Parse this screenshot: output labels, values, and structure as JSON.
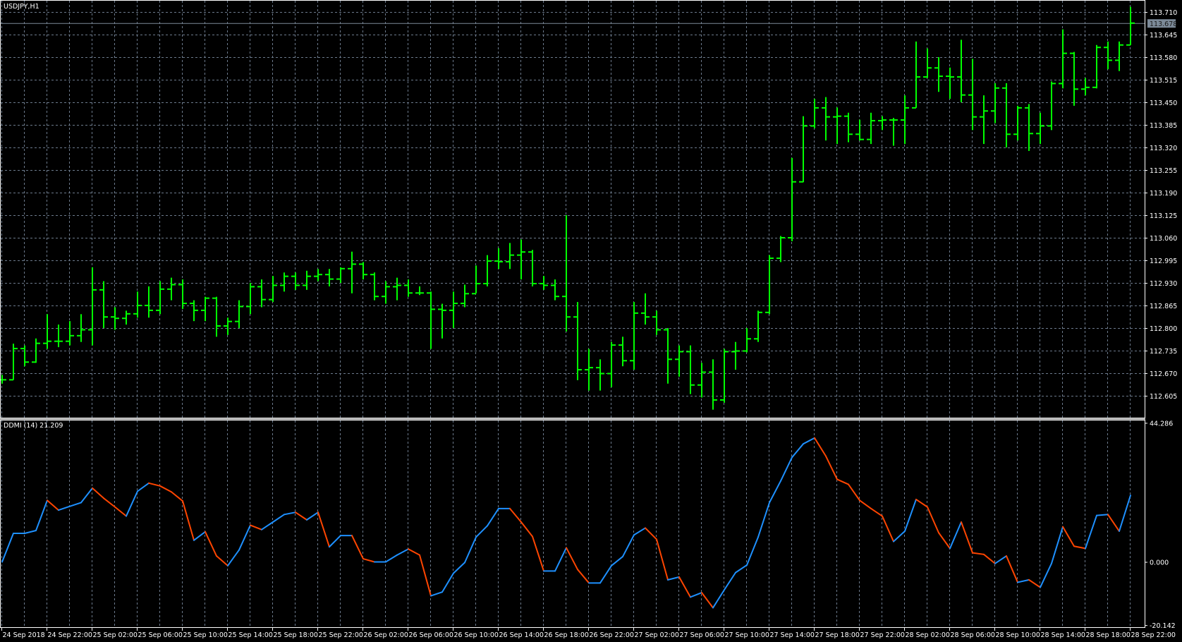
{
  "chart_data": [
    {
      "type": "ohlc",
      "title": "USDJPY,H1",
      "current_price": "113.678",
      "ylim": [
        112.542,
        113.745
      ],
      "y_ticks": [
        "113.710",
        "113.645",
        "113.580",
        "113.515",
        "113.450",
        "113.385",
        "113.320",
        "113.255",
        "113.190",
        "113.125",
        "113.060",
        "112.995",
        "112.930",
        "112.865",
        "112.800",
        "112.735",
        "112.670",
        "112.605"
      ],
      "close": [
        112.651,
        112.741,
        112.702,
        112.756,
        112.762,
        112.762,
        112.778,
        112.795,
        112.91,
        112.832,
        112.828,
        112.841,
        112.865,
        112.851,
        112.912,
        112.925,
        112.871,
        112.851,
        112.886,
        112.806,
        112.819,
        112.862,
        112.919,
        112.882,
        112.923,
        112.949,
        112.923,
        112.949,
        112.954,
        112.941,
        112.971,
        112.984,
        112.954,
        112.891,
        112.919,
        112.923,
        112.901,
        112.901,
        112.854,
        112.851,
        112.871,
        112.899,
        112.928,
        112.993,
        112.991,
        113.01,
        113.019,
        112.928,
        112.923,
        112.891,
        112.832,
        112.68,
        112.686,
        112.669,
        112.751,
        112.706,
        112.843,
        112.832,
        112.795,
        112.71,
        112.732,
        112.636,
        112.673,
        112.593,
        112.732,
        112.734,
        112.769,
        112.845,
        113.001,
        113.06,
        113.221,
        113.382,
        113.434,
        113.408,
        113.41,
        113.358,
        113.343,
        113.397,
        113.399,
        113.399,
        113.434,
        113.523,
        113.549,
        113.525,
        113.523,
        113.471,
        113.408,
        113.425,
        113.491,
        113.358,
        113.434,
        113.36,
        113.382,
        113.504,
        113.591,
        113.488,
        113.493,
        113.608,
        113.571,
        113.615,
        113.678
      ],
      "high": [
        112.665,
        112.755,
        112.75,
        112.77,
        112.84,
        112.81,
        112.82,
        112.84,
        112.975,
        112.935,
        112.86,
        112.85,
        112.905,
        112.92,
        112.935,
        112.945,
        112.94,
        112.88,
        112.89,
        112.89,
        112.83,
        112.88,
        112.93,
        112.94,
        112.95,
        112.96,
        112.96,
        112.965,
        112.97,
        112.97,
        112.975,
        113.02,
        112.99,
        112.96,
        112.935,
        112.945,
        112.94,
        112.92,
        112.905,
        112.87,
        112.905,
        112.925,
        112.98,
        113.01,
        113.03,
        113.045,
        113.055,
        113.025,
        112.95,
        112.94,
        113.125,
        112.875,
        112.74,
        112.71,
        112.76,
        112.775,
        112.875,
        112.9,
        112.85,
        112.8,
        112.75,
        112.75,
        112.7,
        112.71,
        112.74,
        112.76,
        112.8,
        112.85,
        113.01,
        113.065,
        113.29,
        113.41,
        113.46,
        113.465,
        113.435,
        113.42,
        113.4,
        113.42,
        113.41,
        113.405,
        113.47,
        113.625,
        113.605,
        113.58,
        113.55,
        113.63,
        113.575,
        113.47,
        113.505,
        113.505,
        113.44,
        113.445,
        113.42,
        113.51,
        113.66,
        113.595,
        113.52,
        113.615,
        113.625,
        113.625,
        113.725
      ],
      "low": [
        112.64,
        112.651,
        112.69,
        112.7,
        112.74,
        112.745,
        112.75,
        112.76,
        112.75,
        112.8,
        112.795,
        112.81,
        112.83,
        112.83,
        112.84,
        112.88,
        112.855,
        112.82,
        112.82,
        112.775,
        112.78,
        112.8,
        112.84,
        112.86,
        112.875,
        112.905,
        112.91,
        112.91,
        112.935,
        112.92,
        112.93,
        112.9,
        112.94,
        112.88,
        112.87,
        112.88,
        112.89,
        112.895,
        112.74,
        112.77,
        112.8,
        112.86,
        112.9,
        112.92,
        112.97,
        112.97,
        112.94,
        112.92,
        112.91,
        112.88,
        112.79,
        112.65,
        112.62,
        112.62,
        112.63,
        112.69,
        112.68,
        112.81,
        112.78,
        112.64,
        112.66,
        112.61,
        112.6,
        112.565,
        112.585,
        112.68,
        112.73,
        112.76,
        112.84,
        112.99,
        113.05,
        113.22,
        113.375,
        113.34,
        113.33,
        113.335,
        113.34,
        113.33,
        113.37,
        113.325,
        113.33,
        113.434,
        113.52,
        113.48,
        113.46,
        113.45,
        113.37,
        113.33,
        113.39,
        113.32,
        113.34,
        113.31,
        113.33,
        113.37,
        113.49,
        113.44,
        113.47,
        113.49,
        113.545,
        113.54,
        113.615
      ],
      "x_labels": [
        "24 Sep 2018",
        "24 Sep 22:00",
        "25 Sep 02:00",
        "25 Sep 06:00",
        "25 Sep 10:00",
        "25 Sep 14:00",
        "25 Sep 18:00",
        "25 Sep 22:00",
        "26 Sep 02:00",
        "26 Sep 06:00",
        "26 Sep 10:00",
        "26 Sep 14:00",
        "26 Sep 18:00",
        "26 Sep 22:00",
        "27 Sep 02:00",
        "27 Sep 06:00",
        "27 Sep 10:00",
        "27 Sep 14:00",
        "27 Sep 18:00",
        "27 Sep 22:00",
        "28 Sep 02:00",
        "28 Sep 06:00",
        "28 Sep 10:00",
        "28 Sep 14:00",
        "28 Sep 18:00",
        "28 Sep 22:00"
      ],
      "bar_color": "#00ff00"
    },
    {
      "type": "line",
      "title": "DDMI (14) 21.209",
      "ylim": [
        -20.142,
        44.286
      ],
      "y_ticks": [
        "44.286",
        "0.000",
        "-20.142"
      ],
      "values": [
        0,
        9.1,
        9.1,
        10,
        19.6,
        16.5,
        17.7,
        18.9,
        23.5,
        20.3,
        17.5,
        14.6,
        22.5,
        25.1,
        24.2,
        22.3,
        19.4,
        6.9,
        9.6,
        1.9,
        -1.2,
        3.8,
        11.7,
        10.3,
        12.7,
        15.1,
        15.8,
        13.4,
        15.8,
        4.8,
        8.4,
        8.4,
        1.0,
        0,
        0,
        2.2,
        4.1,
        2.2,
        -10.8,
        -9.6,
        -3.6,
        -0.2,
        7.9,
        11.5,
        17.0,
        17.0,
        12.7,
        8.1,
        -2.9,
        -2.9,
        4.5,
        -2.4,
        -6.7,
        -6.7,
        -1.2,
        1.7,
        8.6,
        10.8,
        7.2,
        -5.7,
        -4.8,
        -11.2,
        -9.8,
        -14.6,
        -8.9,
        -3.4,
        -1.0,
        7.9,
        18.9,
        25.8,
        33.3,
        37.6,
        39.5,
        33.7,
        26.3,
        24.7,
        19.6,
        17.0,
        14.6,
        6.5,
        9.8,
        19.9,
        17.5,
        9.3,
        4.3,
        12.7,
        2.9,
        2.4,
        -0.5,
        1.9,
        -6.5,
        -5.7,
        -8.1,
        -0.5,
        11.2,
        5.0,
        4.3,
        14.8,
        15.1,
        9.8,
        21.209
      ],
      "up_color": "#1e90ff",
      "down_color": "#ff4500"
    }
  ]
}
